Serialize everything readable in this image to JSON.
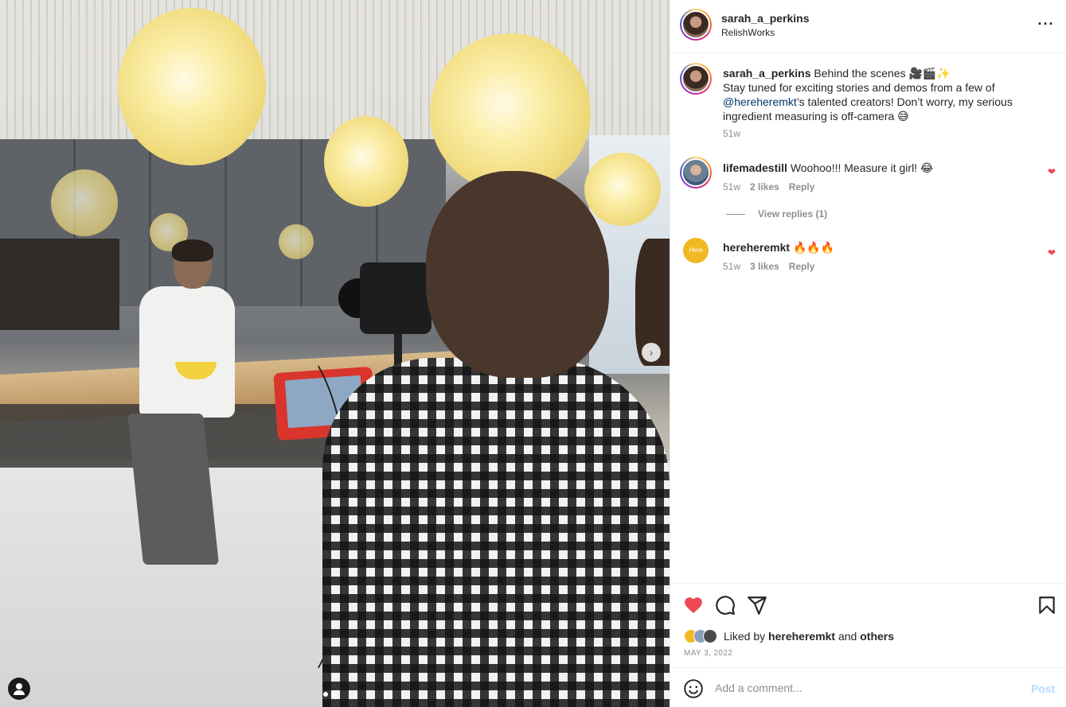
{
  "header": {
    "username": "sarah_a_perkins",
    "location": "RelishWorks",
    "more_icon": "more-horizontal-icon"
  },
  "caption": {
    "username": "sarah_a_perkins",
    "text_1": "Behind the scenes 🎥🎬✨",
    "text_2": "Stay tuned for exciting stories and demos from a few of",
    "mention": "@hereheremkt",
    "text_3": "’s talented creators! Don’t worry, my serious ingredient measuring is off-camera 😅",
    "time": "51w"
  },
  "comments": [
    {
      "username": "lifemadestill",
      "text": "Woohoo!!! Measure it girl! 😂",
      "time": "51w",
      "likes": "2 likes",
      "reply": "Reply",
      "view_replies": "View replies (1)"
    },
    {
      "username": "hereheremkt",
      "text": "🔥🔥🔥",
      "time": "51w",
      "likes": "3 likes",
      "reply": "Reply",
      "avatar_text": "Here Here"
    }
  ],
  "actions": {
    "like_icon": "heart-filled-icon",
    "comment_icon": "comment-icon",
    "share_icon": "send-icon",
    "save_icon": "bookmark-icon",
    "liked_prefix": "Liked by",
    "liked_user": "hereheremkt",
    "liked_and": "and",
    "liked_others": "others",
    "date": "MAY 3, 2022"
  },
  "add_comment": {
    "placeholder": "Add a comment...",
    "post_label": "Post"
  },
  "colors": {
    "like_red": "#ed4956",
    "mention_blue": "#00376b",
    "post_disabled": "#b3dbff"
  },
  "carousel": {
    "total": 2,
    "current": 1
  }
}
